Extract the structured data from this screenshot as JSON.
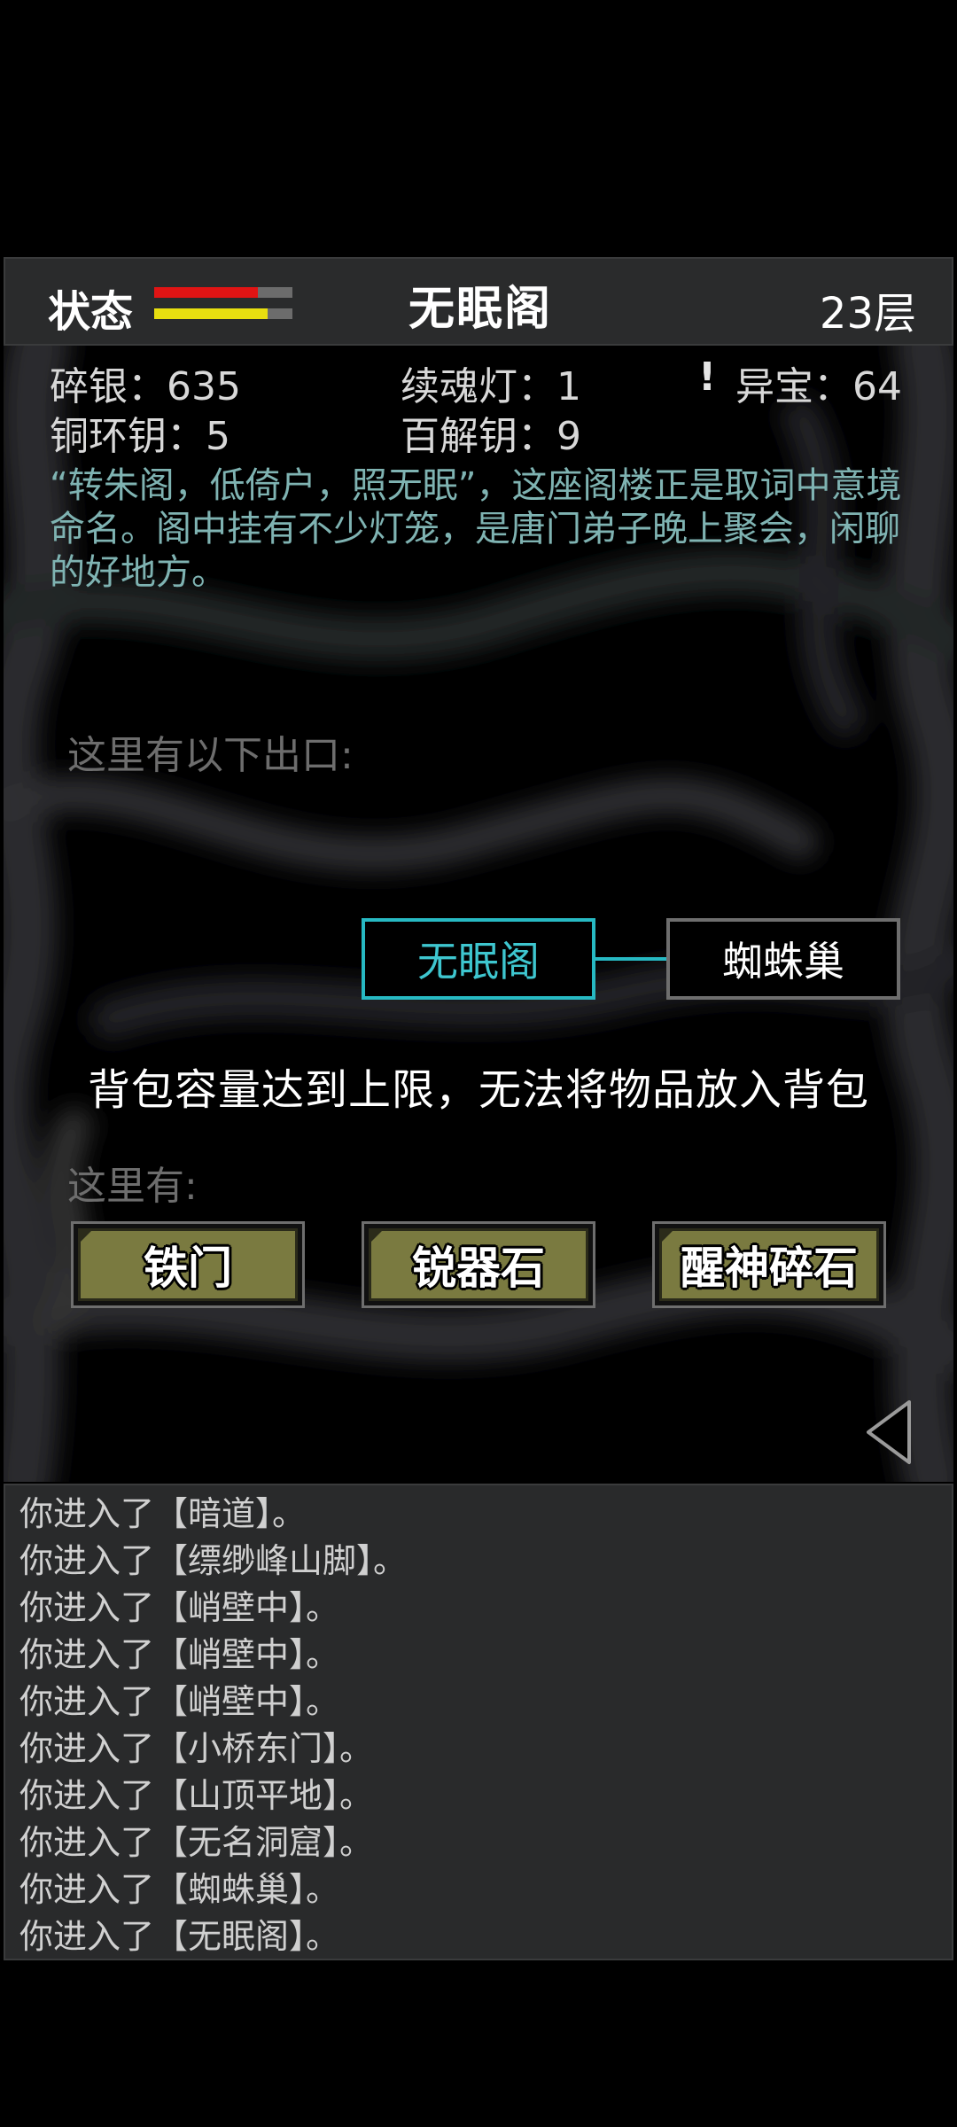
{
  "header": {
    "status_label": "状态",
    "hp_fraction": 0.75,
    "mp_fraction": 0.82,
    "hp_color": "#e01414",
    "mp_color": "#e8df10",
    "room_title": "无眠阁",
    "floor": "23层"
  },
  "stats": {
    "silver": "碎银：635",
    "soul_lamp": "续魂灯：1",
    "treasure": "异宝：64",
    "copper_key": "铜环钥：5",
    "master_key": "百解钥：9",
    "alert_icon": "!"
  },
  "description": "“转朱阁，低倚户，照无眠”，这座阁楼正是取词中意境命名。阁中挂有不少灯笼，是唐门弟子晚上聚会，闲聊的好地方。",
  "exits": {
    "label": "这里有以下出口:",
    "current": "无眠阁",
    "other": "蜘蛛巢",
    "accent_color": "#27b9c3"
  },
  "notice": "背包容量达到上限，无法将物品放入背包",
  "items": {
    "label": "这里有:",
    "list": [
      "铁门",
      "锐器石",
      "醒神碎石"
    ]
  },
  "log": [
    "你进入了【暗道】。",
    "你进入了【缥缈峰山脚】。",
    "你进入了【峭壁中】。",
    "你进入了【峭壁中】。",
    "你进入了【峭壁中】。",
    "你进入了【小桥东门】。",
    "你进入了【山顶平地】。",
    "你进入了【无名洞窟】。",
    "你进入了【蜘蛛巢】。",
    "你进入了【无眠阁】。"
  ]
}
